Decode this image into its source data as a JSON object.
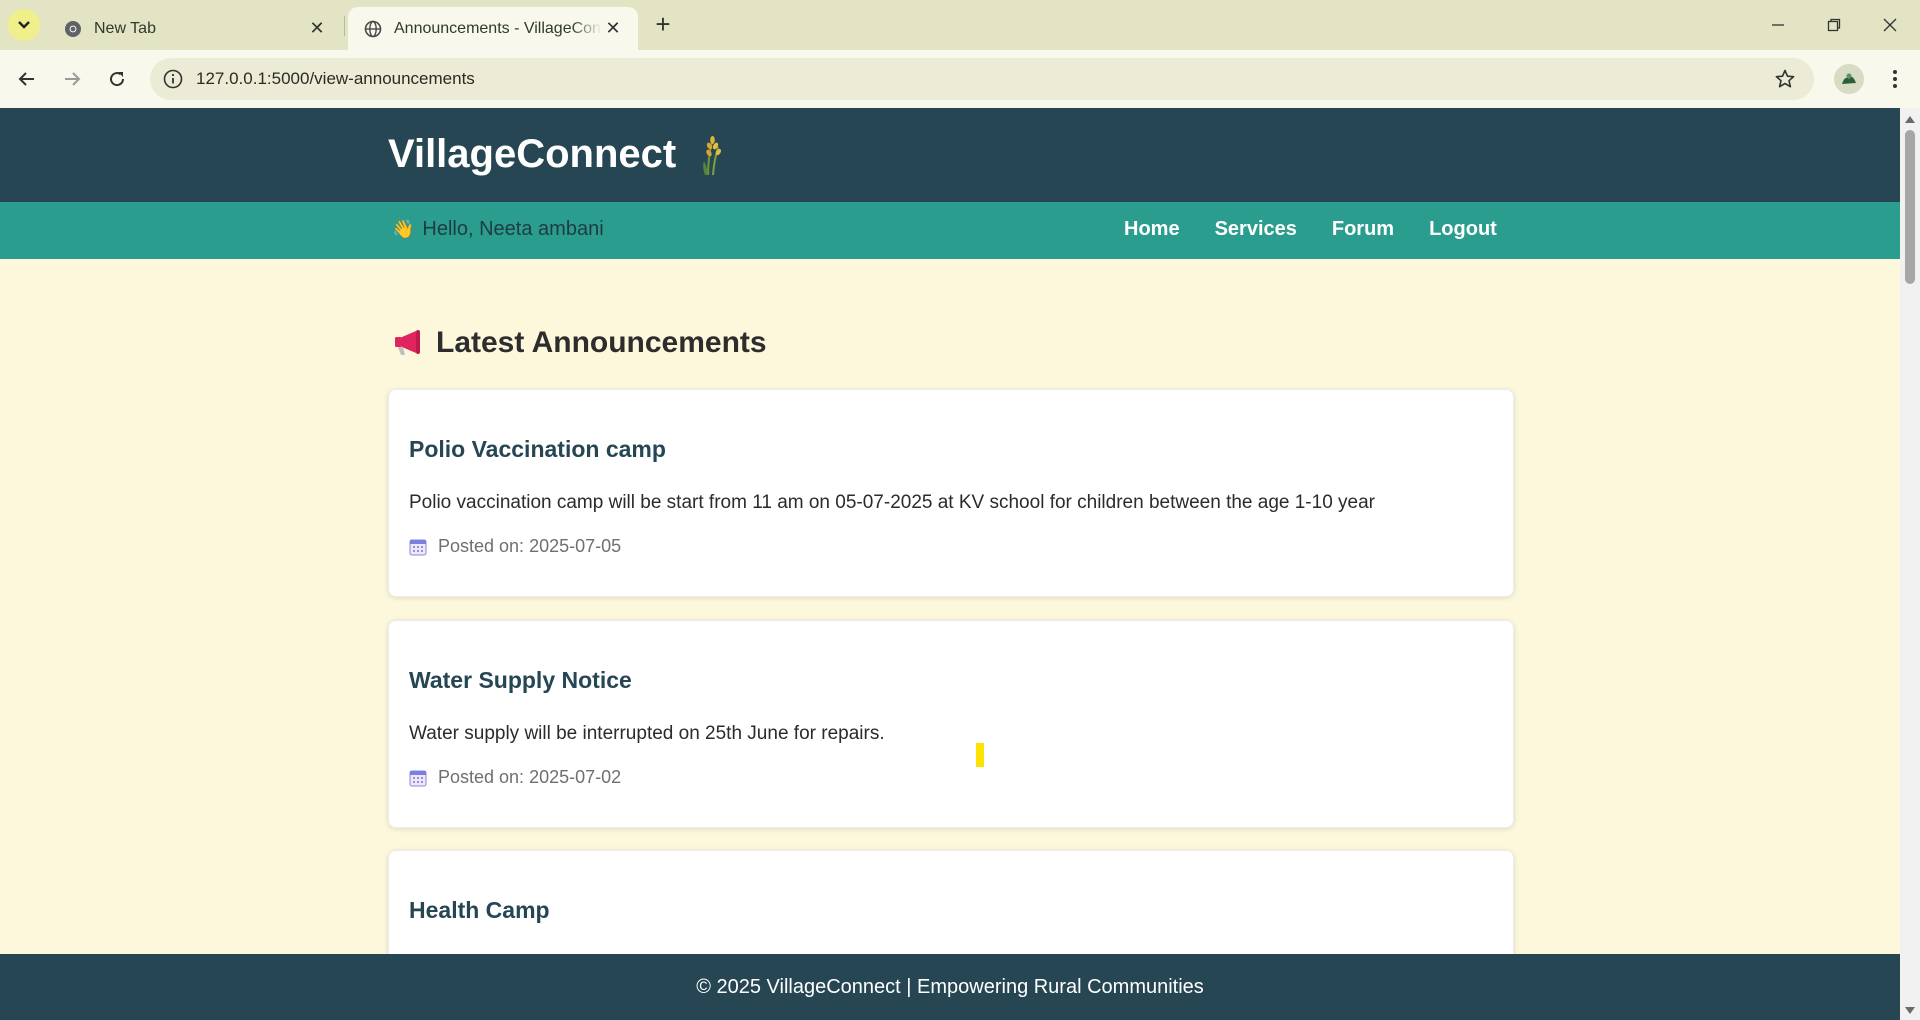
{
  "browser": {
    "tabs": [
      {
        "title": "New Tab",
        "icon": "chrome-icon",
        "active": false
      },
      {
        "title": "Announcements - VillageConnect",
        "icon": "globe-icon",
        "active": true
      }
    ],
    "address": "127.0.0.1:5000/view-announcements"
  },
  "site": {
    "brand": "VillageConnect",
    "brand_icon": "wheat-icon",
    "greeting": "Hello, Neeta ambani",
    "nav": [
      "Home",
      "Services",
      "Forum",
      "Logout"
    ],
    "colors": {
      "header": "#264653",
      "nav": "#2a9d8f",
      "background": "#fdf8dc",
      "card_title": "#264653"
    }
  },
  "main": {
    "heading": "Latest Announcements",
    "announcements": [
      {
        "title": "Polio Vaccination camp",
        "body": "Polio vaccination camp will be start from 11 am on 05-07-2025 at KV school for children between the age 1-10 year",
        "date": "Posted on: 2025-07-05"
      },
      {
        "title": "Water Supply Notice",
        "body": "Water supply will be interrupted on 25th June for repairs.",
        "date": "Posted on: 2025-07-02"
      },
      {
        "title": "Health Camp"
      }
    ]
  },
  "footer": {
    "text": "© 2025 VillageConnect | Empowering Rural Communities"
  }
}
